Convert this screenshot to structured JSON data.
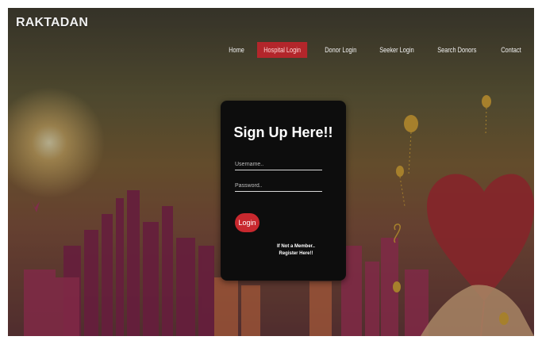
{
  "brand": {
    "name": "RAKTADAN"
  },
  "nav": {
    "items": [
      {
        "label": "Home"
      },
      {
        "label": "Hospital Login",
        "active": true
      },
      {
        "label": "Donor Login"
      },
      {
        "label": "Seeker Login"
      },
      {
        "label": "Search Donors"
      },
      {
        "label": "Contact"
      }
    ]
  },
  "form": {
    "title": "Sign Up Here!!",
    "username_placeholder": "Username..",
    "password_placeholder": "Password..",
    "login_label": "Login",
    "note_line1": "If Not a Member..",
    "note_line2": "Register Here!!"
  },
  "colors": {
    "accent": "#c8282e",
    "card": "#0d0d0d"
  },
  "icons": [
    "heart-balloon-icon",
    "bird-icon"
  ]
}
